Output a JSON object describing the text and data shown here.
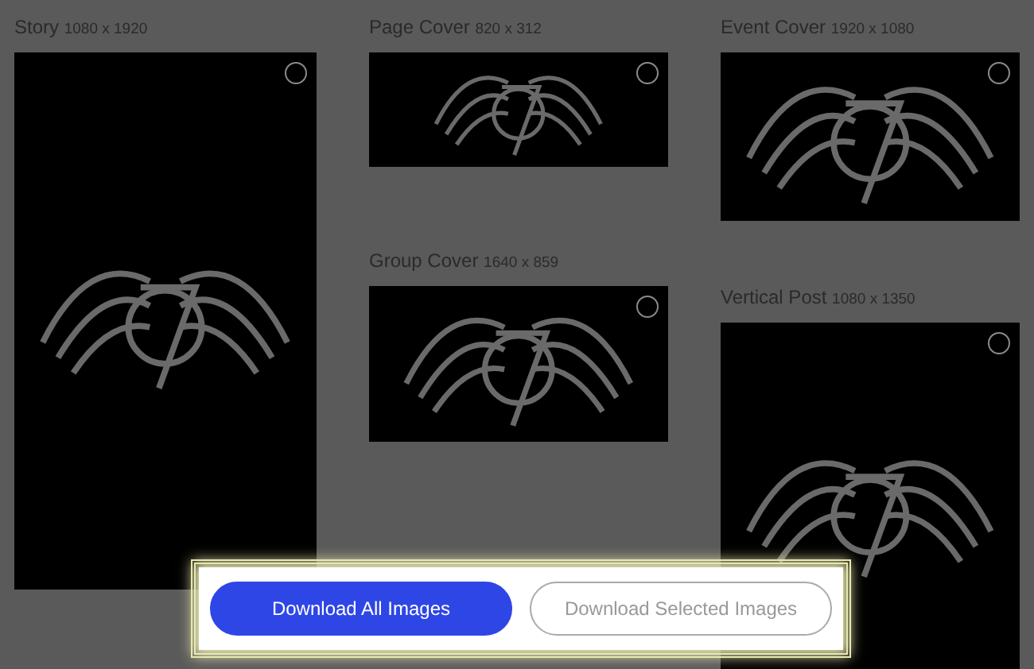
{
  "columns": [
    {
      "cards": [
        {
          "title": "Story",
          "size": "1080 x 1920",
          "selected": false
        }
      ]
    },
    {
      "cards": [
        {
          "title": "Page Cover",
          "size": "820 x 312",
          "selected": false
        },
        {
          "title": "Group Cover",
          "size": "1640 x 859",
          "selected": false
        }
      ]
    },
    {
      "cards": [
        {
          "title": "Event Cover",
          "size": "1920 x 1080",
          "selected": false
        },
        {
          "title": "Vertical Post",
          "size": "1080 x 1350",
          "selected": false
        }
      ]
    }
  ],
  "actions": [
    {
      "label": "Download All Images",
      "kind": "primary"
    },
    {
      "label": "Download Selected Images",
      "kind": "secondary"
    }
  ]
}
